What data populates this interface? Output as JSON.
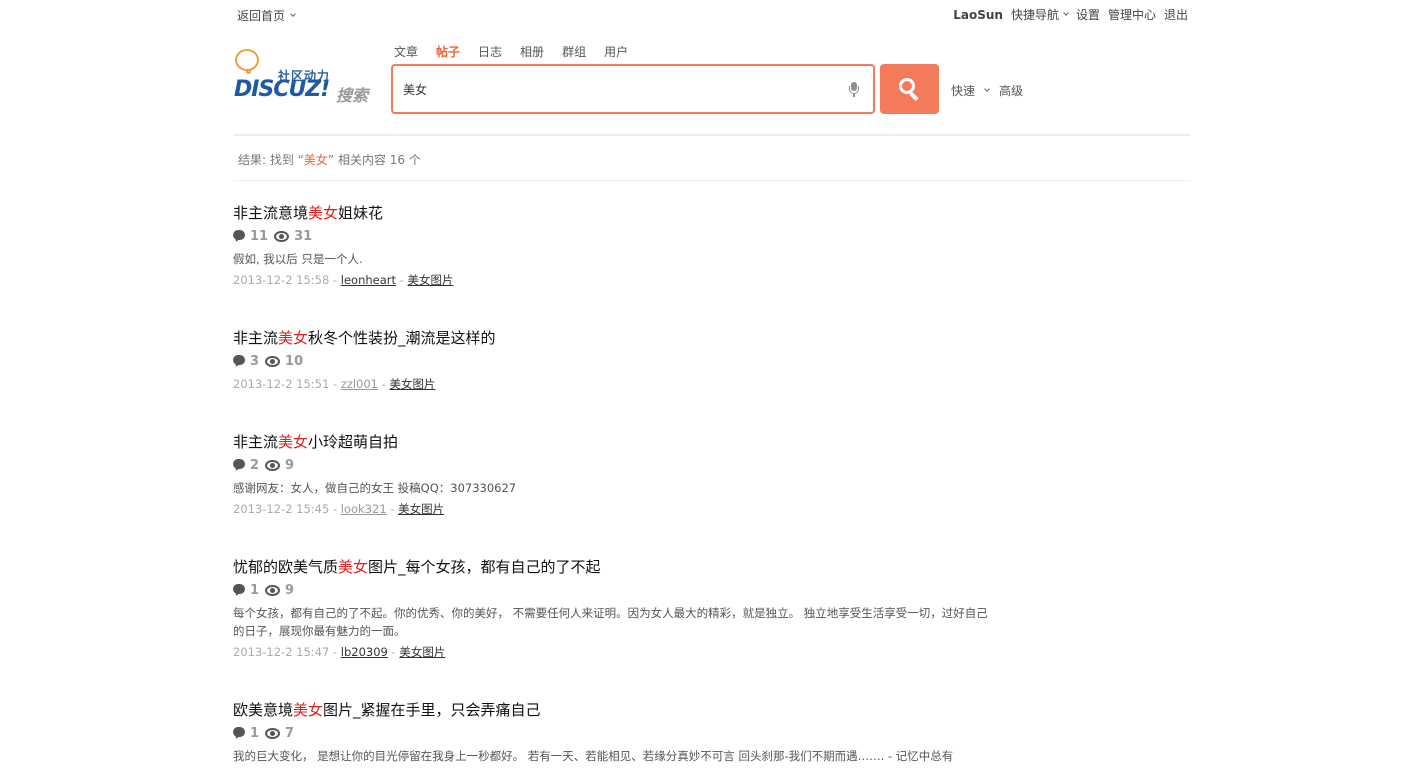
{
  "topbar": {
    "home_label": "返回首页",
    "username": "LaoSun",
    "quicknav_label": "快捷导航",
    "settings_label": "设置",
    "admin_label": "管理中心",
    "logout_label": "退出"
  },
  "logo": {
    "slogan": "社区动力",
    "brand": "DISCUZ!",
    "sub": "搜索"
  },
  "search_tabs": [
    {
      "label": "文章"
    },
    {
      "label": "帖子"
    },
    {
      "label": "日志"
    },
    {
      "label": "相册"
    },
    {
      "label": "群组"
    },
    {
      "label": "用户"
    }
  ],
  "search": {
    "value": "美女",
    "mode_label": "快速",
    "advanced_label": "高级"
  },
  "summary": {
    "prefix": "结果: 找到 “",
    "keyword": "美女",
    "suffix": "” 相关内容 16 个"
  },
  "results": [
    {
      "title_before": "非主流意境",
      "title_hl": "美女",
      "title_after": "姐妹花",
      "replies": "11",
      "views": "31",
      "summary": "假如, 我以后 只是一个人.",
      "date": "2013-12-2 15:58",
      "author": "leonheart",
      "forum": "美女图片"
    },
    {
      "title_before": "非主流",
      "title_hl": "美女",
      "title_after": "秋冬个性装扮_潮流是这样的",
      "replies": "3",
      "views": "10",
      "summary": "",
      "date": "2013-12-2 15:51",
      "author": "zzl001",
      "forum": "美女图片"
    },
    {
      "title_before": "非主流",
      "title_hl": "美女",
      "title_after": "小玲超萌自拍",
      "replies": "2",
      "views": "9",
      "summary": "感谢网友：女人，做自己的女王 投稿QQ：307330627",
      "date": "2013-12-2 15:45",
      "author": "look321",
      "forum": "美女图片"
    },
    {
      "title_before": "忧郁的欧美气质",
      "title_hl": "美女",
      "title_after": "图片_每个女孩，都有自己的了不起",
      "replies": "1",
      "views": "9",
      "summary": "每个女孩，都有自己的了不起。你的优秀、你的美好， 不需要任何人来证明。因为女人最大的精彩，就是独立。 独立地享受生活享受一切，过好自己的日子，展现你最有魅力的一面。",
      "date": "2013-12-2 15:47",
      "author": "lb20309",
      "forum": "美女图片"
    },
    {
      "title_before": "欧美意境",
      "title_hl": "美女",
      "title_after": "图片_紧握在手里，只会弄痛自己",
      "replies": "1",
      "views": "7",
      "summary": "我的巨大变化， 是想让你的目光停留在我身上一秒都好。 若有一天、若能相见、若缘分真妙不可言 回头刹那-我们不期而遇……. - 记忆中总有",
      "date": "",
      "author": "",
      "forum": ""
    }
  ]
}
